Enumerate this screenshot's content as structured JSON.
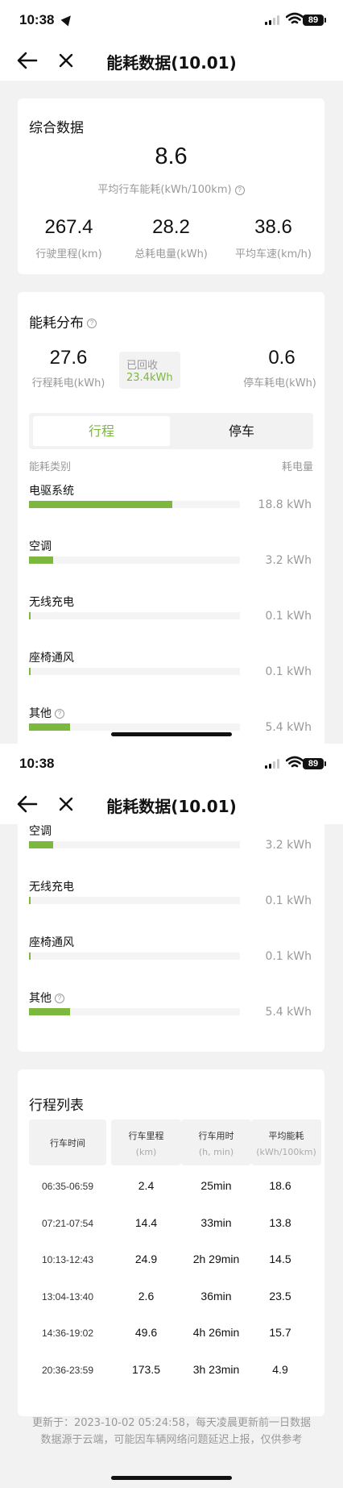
{
  "status": {
    "time": "10:38",
    "battery": "89"
  },
  "nav": {
    "title": "能耗数据(10.01)"
  },
  "summary": {
    "title": "综合数据",
    "avg_value": "8.6",
    "avg_label": "平均行车能耗(kWh/100km)",
    "stats": [
      {
        "value": "267.4",
        "label": "行驶里程(km)"
      },
      {
        "value": "28.2",
        "label": "总耗电量(kWh)"
      },
      {
        "value": "38.6",
        "label": "平均车速(km/h)"
      }
    ]
  },
  "distribution": {
    "title": "能耗分布",
    "drive_value": "27.6",
    "drive_label": "行程耗电(kWh)",
    "recovered_label": "已回收",
    "recovered_value": "23.4kWh",
    "park_value": "0.6",
    "park_label": "停车耗电(kWh)",
    "tabs": [
      "行程",
      "停车"
    ],
    "category_header": "能耗类别",
    "value_header": "耗电量",
    "categories": [
      {
        "name": "电驱系统",
        "value": "18.8 kWh",
        "fraction": 0.68
      },
      {
        "name": "空调",
        "value": "3.2 kWh",
        "fraction": 0.116
      },
      {
        "name": "无线充电",
        "value": "0.1 kWh",
        "fraction": 0.004
      },
      {
        "name": "座椅通风",
        "value": "0.1 kWh",
        "fraction": 0.004
      },
      {
        "name": "其他",
        "value": "5.4 kWh",
        "fraction": 0.196
      }
    ]
  },
  "trips": {
    "title": "行程列表",
    "headers": [
      {
        "label": "行车时间",
        "unit": ""
      },
      {
        "label": "行车里程",
        "unit": "(km)"
      },
      {
        "label": "行车用时",
        "unit": "(h, min)"
      },
      {
        "label": "平均能耗",
        "unit": "(kWh/100km)"
      }
    ],
    "rows": [
      [
        "06:35-06:59",
        "2.4",
        "25min",
        "18.6"
      ],
      [
        "07:21-07:54",
        "14.4",
        "33min",
        "13.8"
      ],
      [
        "10:13-12:43",
        "24.9",
        "2h 29min",
        "14.5"
      ],
      [
        "13:04-13:40",
        "2.6",
        "36min",
        "23.5"
      ],
      [
        "14:36-19:02",
        "49.6",
        "4h 26min",
        "15.7"
      ],
      [
        "20:36-23:59",
        "173.5",
        "3h 23min",
        "4.9"
      ]
    ]
  },
  "footer": {
    "line1": "更新于：2023-10-02 05:24:58，每天凌晨更新前一日数据",
    "line2": "数据源于云端，可能因车辆网络问题延迟上报，仅供参考"
  },
  "colors": {
    "accent": "#7bb83d",
    "muted": "#999999",
    "bg": "#f2f2f2"
  }
}
